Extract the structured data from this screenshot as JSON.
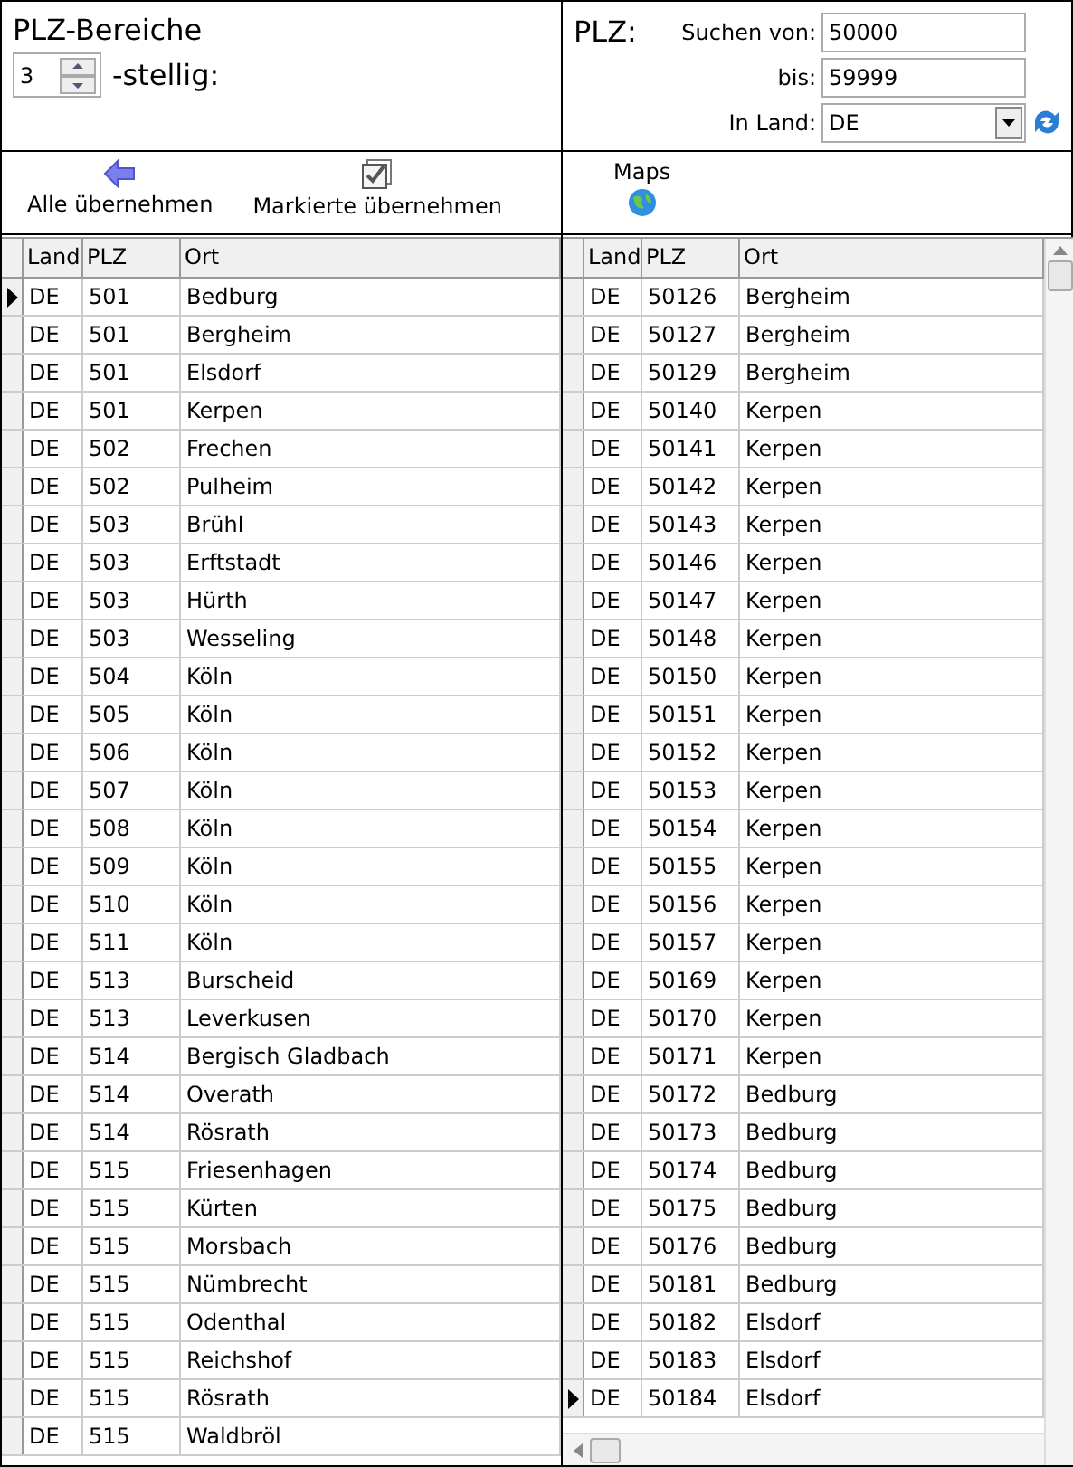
{
  "left_panel": {
    "title": "PLZ-Bereiche",
    "digits": {
      "value": "3"
    },
    "digits_label": "-stellig:"
  },
  "search_panel": {
    "label": "PLZ:",
    "from_label": "Suchen von:",
    "from_value": "50000",
    "to_label": "bis:",
    "to_value": "59999",
    "country_label": "In Land:",
    "country_value": "DE"
  },
  "left_toolbar": [
    {
      "kind": "arrow",
      "label": "Alle übernehmen"
    },
    {
      "kind": "check",
      "label": "Markierte übernehmen"
    }
  ],
  "right_toolbar": [
    {
      "kind": "globe",
      "label": "Maps"
    }
  ],
  "left_table": {
    "columns": [
      "Land",
      "PLZ",
      "Ort"
    ],
    "rows": [
      {
        "cells": [
          "DE",
          "501",
          "Bedburg"
        ],
        "selected": true
      },
      {
        "cells": [
          "DE",
          "501",
          "Bergheim"
        ],
        "selected": false
      },
      {
        "cells": [
          "DE",
          "501",
          "Elsdorf"
        ],
        "selected": false
      },
      {
        "cells": [
          "DE",
          "501",
          "Kerpen"
        ],
        "selected": false
      },
      {
        "cells": [
          "DE",
          "502",
          "Frechen"
        ],
        "selected": false
      },
      {
        "cells": [
          "DE",
          "502",
          "Pulheim"
        ],
        "selected": false
      },
      {
        "cells": [
          "DE",
          "503",
          "Brühl"
        ],
        "selected": false
      },
      {
        "cells": [
          "DE",
          "503",
          "Erftstadt"
        ],
        "selected": false
      },
      {
        "cells": [
          "DE",
          "503",
          "Hürth"
        ],
        "selected": false
      },
      {
        "cells": [
          "DE",
          "503",
          "Wesseling"
        ],
        "selected": false
      },
      {
        "cells": [
          "DE",
          "504",
          "Köln"
        ],
        "selected": false
      },
      {
        "cells": [
          "DE",
          "505",
          "Köln"
        ],
        "selected": false
      },
      {
        "cells": [
          "DE",
          "506",
          "Köln"
        ],
        "selected": false
      },
      {
        "cells": [
          "DE",
          "507",
          "Köln"
        ],
        "selected": false
      },
      {
        "cells": [
          "DE",
          "508",
          "Köln"
        ],
        "selected": false
      },
      {
        "cells": [
          "DE",
          "509",
          "Köln"
        ],
        "selected": false
      },
      {
        "cells": [
          "DE",
          "510",
          "Köln"
        ],
        "selected": false
      },
      {
        "cells": [
          "DE",
          "511",
          "Köln"
        ],
        "selected": false
      },
      {
        "cells": [
          "DE",
          "513",
          "Burscheid"
        ],
        "selected": false
      },
      {
        "cells": [
          "DE",
          "513",
          "Leverkusen"
        ],
        "selected": false
      },
      {
        "cells": [
          "DE",
          "514",
          "Bergisch Gladbach"
        ],
        "selected": false
      },
      {
        "cells": [
          "DE",
          "514",
          "Overath"
        ],
        "selected": false
      },
      {
        "cells": [
          "DE",
          "514",
          "Rösrath"
        ],
        "selected": false
      },
      {
        "cells": [
          "DE",
          "515",
          "Friesenhagen"
        ],
        "selected": false
      },
      {
        "cells": [
          "DE",
          "515",
          "Kürten"
        ],
        "selected": false
      },
      {
        "cells": [
          "DE",
          "515",
          "Morsbach"
        ],
        "selected": false
      },
      {
        "cells": [
          "DE",
          "515",
          "Nümbrecht"
        ],
        "selected": false
      },
      {
        "cells": [
          "DE",
          "515",
          "Odenthal"
        ],
        "selected": false
      },
      {
        "cells": [
          "DE",
          "515",
          "Reichshof"
        ],
        "selected": false
      },
      {
        "cells": [
          "DE",
          "515",
          "Rösrath"
        ],
        "selected": false
      },
      {
        "cells": [
          "DE",
          "515",
          "Waldbröl"
        ],
        "selected": false
      }
    ]
  },
  "right_table": {
    "columns": [
      "Land",
      "PLZ",
      "Ort"
    ],
    "rows": [
      {
        "cells": [
          "DE",
          "50126",
          "Bergheim"
        ],
        "selected": false
      },
      {
        "cells": [
          "DE",
          "50127",
          "Bergheim"
        ],
        "selected": false
      },
      {
        "cells": [
          "DE",
          "50129",
          "Bergheim"
        ],
        "selected": false
      },
      {
        "cells": [
          "DE",
          "50140",
          "Kerpen"
        ],
        "selected": false
      },
      {
        "cells": [
          "DE",
          "50141",
          "Kerpen"
        ],
        "selected": false
      },
      {
        "cells": [
          "DE",
          "50142",
          "Kerpen"
        ],
        "selected": false
      },
      {
        "cells": [
          "DE",
          "50143",
          "Kerpen"
        ],
        "selected": false
      },
      {
        "cells": [
          "DE",
          "50146",
          "Kerpen"
        ],
        "selected": false
      },
      {
        "cells": [
          "DE",
          "50147",
          "Kerpen"
        ],
        "selected": false
      },
      {
        "cells": [
          "DE",
          "50148",
          "Kerpen"
        ],
        "selected": false
      },
      {
        "cells": [
          "DE",
          "50150",
          "Kerpen"
        ],
        "selected": false
      },
      {
        "cells": [
          "DE",
          "50151",
          "Kerpen"
        ],
        "selected": false
      },
      {
        "cells": [
          "DE",
          "50152",
          "Kerpen"
        ],
        "selected": false
      },
      {
        "cells": [
          "DE",
          "50153",
          "Kerpen"
        ],
        "selected": false
      },
      {
        "cells": [
          "DE",
          "50154",
          "Kerpen"
        ],
        "selected": false
      },
      {
        "cells": [
          "DE",
          "50155",
          "Kerpen"
        ],
        "selected": false
      },
      {
        "cells": [
          "DE",
          "50156",
          "Kerpen"
        ],
        "selected": false
      },
      {
        "cells": [
          "DE",
          "50157",
          "Kerpen"
        ],
        "selected": false
      },
      {
        "cells": [
          "DE",
          "50169",
          "Kerpen"
        ],
        "selected": false
      },
      {
        "cells": [
          "DE",
          "50170",
          "Kerpen"
        ],
        "selected": false
      },
      {
        "cells": [
          "DE",
          "50171",
          "Kerpen"
        ],
        "selected": false
      },
      {
        "cells": [
          "DE",
          "50172",
          "Bedburg"
        ],
        "selected": false
      },
      {
        "cells": [
          "DE",
          "50173",
          "Bedburg"
        ],
        "selected": false
      },
      {
        "cells": [
          "DE",
          "50174",
          "Bedburg"
        ],
        "selected": false
      },
      {
        "cells": [
          "DE",
          "50175",
          "Bedburg"
        ],
        "selected": false
      },
      {
        "cells": [
          "DE",
          "50176",
          "Bedburg"
        ],
        "selected": false
      },
      {
        "cells": [
          "DE",
          "50181",
          "Bedburg"
        ],
        "selected": false
      },
      {
        "cells": [
          "DE",
          "50182",
          "Elsdorf"
        ],
        "selected": false
      },
      {
        "cells": [
          "DE",
          "50183",
          "Elsdorf"
        ],
        "selected": false
      },
      {
        "cells": [
          "DE",
          "50184",
          "Elsdorf"
        ],
        "selected": true
      }
    ]
  }
}
